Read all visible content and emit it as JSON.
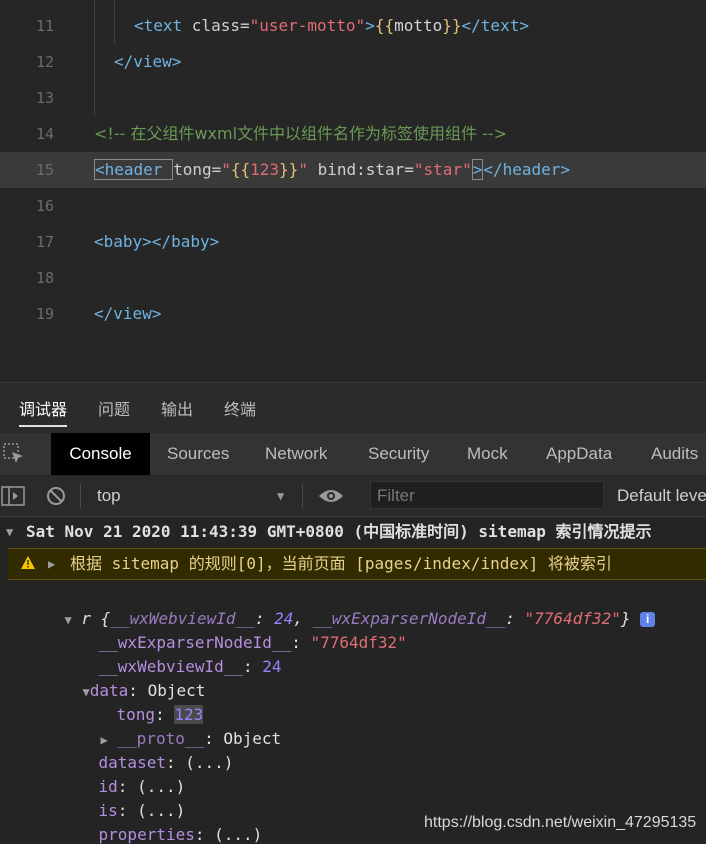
{
  "editor": {
    "lines": [
      {
        "num": "11",
        "parts": [
          {
            "t": "<text ",
            "c": "tag"
          },
          {
            "t": "class=",
            "c": "attr"
          },
          {
            "t": "\"user-motto\"",
            "c": "str"
          },
          {
            "t": ">",
            "c": "tag"
          },
          {
            "t": "{{",
            "c": "brace"
          },
          {
            "t": "motto",
            "c": "plain"
          },
          {
            "t": "}}",
            "c": "brace"
          },
          {
            "t": "</text>",
            "c": "tag"
          }
        ]
      },
      {
        "num": "12",
        "parts": [
          {
            "t": "</view>",
            "c": "tag"
          }
        ]
      },
      {
        "num": "13",
        "parts": []
      },
      {
        "num": "14",
        "parts": [
          {
            "t": "<!-- 在父组件wxml文件中以组件名作为标签使用组件 -->",
            "c": "cmt"
          }
        ]
      },
      {
        "num": "15",
        "parts": [
          {
            "t": "<header ",
            "c": "tag"
          },
          {
            "t": "tong=",
            "c": "attr"
          },
          {
            "t": "\"",
            "c": "str"
          },
          {
            "t": "{{",
            "c": "brace"
          },
          {
            "t": "123",
            "c": "str"
          },
          {
            "t": "}}",
            "c": "brace"
          },
          {
            "t": "\" ",
            "c": "str"
          },
          {
            "t": "bind:star=",
            "c": "attr"
          },
          {
            "t": "\"star\"",
            "c": "str"
          },
          {
            "t": ">",
            "c": "tag"
          },
          {
            "t": "</header>",
            "c": "tag"
          }
        ]
      },
      {
        "num": "16",
        "parts": []
      },
      {
        "num": "17",
        "parts": [
          {
            "t": "<baby></baby>",
            "c": "tag"
          }
        ]
      },
      {
        "num": "18",
        "parts": []
      },
      {
        "num": "19",
        "parts": [
          {
            "t": "</view>",
            "c": "tag"
          }
        ]
      }
    ]
  },
  "panel_tabs": [
    "调试器",
    "问题",
    "输出",
    "终端"
  ],
  "devtools_tabs": [
    "Console",
    "Sources",
    "Network",
    "Security",
    "Mock",
    "AppData",
    "Audits"
  ],
  "toolbar": {
    "context": "top",
    "filter_placeholder": "Filter",
    "levels": "Default levels"
  },
  "console": {
    "group_header": "Sat Nov 21 2020 11:43:39 GMT+0800 (中国标准时间) sitemap 索引情况提示",
    "warning": "根据 sitemap 的规则[0]，当前页面 [pages/index/index] 将被索引",
    "obj_var": "r",
    "obj_summary": {
      "key1": "__wxWebviewId__",
      "val1": "24",
      "key2": "__wxExparserNodeId__",
      "val2": "\"7764df32\""
    },
    "props": {
      "exparser_key": "__wxExparserNodeId__",
      "exparser_val": "\"7764df32\"",
      "webview_key": "__wxWebviewId__",
      "webview_val": "24",
      "data_key": "data",
      "data_val": "Object",
      "tong_key": "tong",
      "tong_val": "123",
      "proto_key": "__proto__",
      "proto_val": "Object",
      "dataset_key": "dataset",
      "lazy": "(...)",
      "id_key": "id",
      "is_key": "is",
      "properties_key": "properties"
    }
  },
  "watermark": "https://blog.csdn.net/weixin_47295135"
}
